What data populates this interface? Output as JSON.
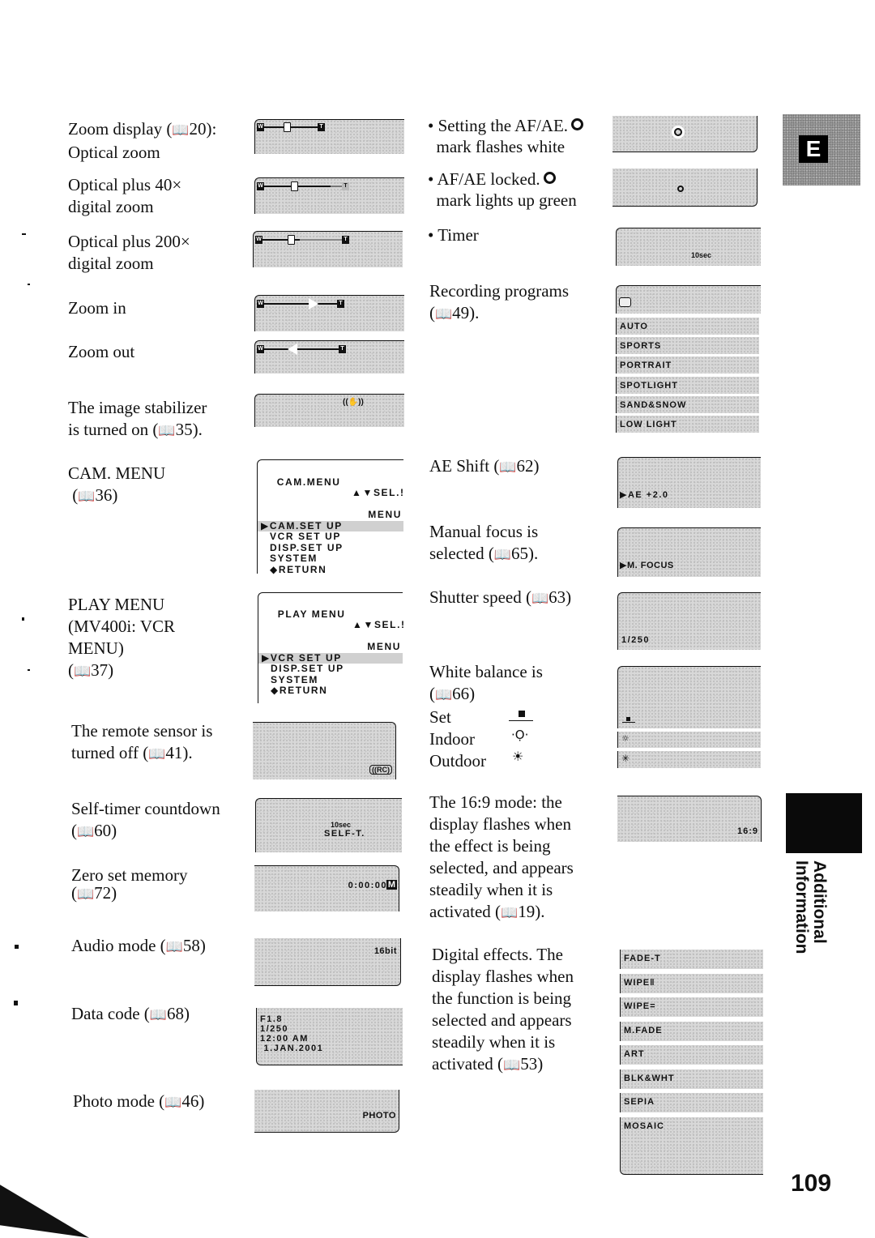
{
  "page_number": "109",
  "section_tab": "E",
  "side_tab_label": [
    "Additional",
    "Information"
  ],
  "book_icon": "book-icon",
  "left_column": [
    {
      "id": "zoom_optical",
      "lines": [
        "Zoom display (",
        "20):",
        "Optical zoom"
      ],
      "ref": "20"
    },
    {
      "id": "zoom_40x",
      "lines": [
        "Optical plus 40×",
        "digital zoom"
      ]
    },
    {
      "id": "zoom_200x",
      "lines": [
        "Optical plus 200×",
        "digital zoom"
      ]
    },
    {
      "id": "zoom_in",
      "lines": [
        "Zoom in"
      ]
    },
    {
      "id": "zoom_out",
      "lines": [
        "Zoom out"
      ]
    },
    {
      "id": "stabilizer",
      "lines": [
        "The image stabilizer",
        "is turned on (",
        "35)."
      ]
    },
    {
      "id": "cam_menu",
      "lines": [
        "CAM. MENU",
        "(",
        "36)"
      ]
    },
    {
      "id": "play_menu",
      "lines": [
        "PLAY MENU",
        "(MV400i: VCR",
        "MENU)",
        "(",
        "37)"
      ]
    },
    {
      "id": "remote",
      "lines": [
        "The remote sensor is",
        "turned off (",
        "41)."
      ]
    },
    {
      "id": "self_timer",
      "lines": [
        "Self-timer countdown",
        "(",
        "60)"
      ]
    },
    {
      "id": "zero_set",
      "lines": [
        "Zero set memory",
        "(",
        "72)"
      ]
    },
    {
      "id": "audio",
      "lines": [
        "Audio mode (",
        "58)"
      ]
    },
    {
      "id": "data_code",
      "lines": [
        "Data code (",
        "68)"
      ]
    },
    {
      "id": "photo",
      "lines": [
        "Photo mode (",
        "46)"
      ]
    }
  ],
  "zoom_bar": {
    "wide_label": "W",
    "tele_label": "T"
  },
  "cam_menu_screen": {
    "title": "CAM.MENU",
    "hint": "▲▼SEL.!",
    "hint2": "MENU",
    "items": [
      "▶CAM.SET UP",
      "VCR SET UP",
      "DISP.SET UP",
      "SYSTEM",
      "◆RETURN"
    ]
  },
  "play_menu_screen": {
    "title": "PLAY MENU",
    "hint": "▲▼SEL.!",
    "hint2": "MENU",
    "items": [
      "▶VCR SET UP",
      "DISP.SET UP",
      "SYSTEM",
      "◆RETURN"
    ]
  },
  "osd": {
    "stabilizer_icon": "((✋))",
    "remote_off": "((RC)",
    "self_timer_sec": "10sec",
    "self_timer_label": "SELF-T.",
    "zero_set": "0:00:00",
    "zero_set_badge": "M",
    "audio": "16bit",
    "data_code": [
      "F1.8",
      "1/250",
      "12:00 AM",
      " 1.JAN.2001"
    ],
    "photo": "PHOTO",
    "timer": "10sec",
    "ae_shift": "▶AE +2.0",
    "manual_focus": "▶M. FOCUS",
    "shutter": "1/250",
    "aspect": "16:9"
  },
  "right_column": {
    "af_setting": [
      "• Setting the AF/AE.",
      "mark flashes white"
    ],
    "af_locked": [
      "• AF/AE locked.",
      "mark lights up green"
    ],
    "timer": [
      "• Timer"
    ],
    "rec_programs": [
      "Recording programs",
      "(",
      "49)."
    ],
    "ae_shift": [
      "AE Shift (",
      "62)"
    ],
    "manual_focus": [
      "Manual focus is",
      "selected (",
      "65)."
    ],
    "shutter": [
      "Shutter speed (",
      "63)"
    ],
    "white_balance": {
      "lines": [
        "White balance is",
        "(",
        "66)"
      ],
      "modes": [
        {
          "label": "Set",
          "icon": "set-wb-icon"
        },
        {
          "label": "Indoor",
          "icon": "bulb-icon"
        },
        {
          "label": "Outdoor",
          "icon": "sun-icon"
        }
      ]
    },
    "aspect": [
      "The 16:9 mode: the",
      "display flashes when",
      "the effect is being",
      "selected, and appears",
      "steadily when it is",
      "activated (",
      "19)."
    ],
    "digital_effects": [
      "Digital effects. The",
      "display flashes when",
      "the function is being",
      "selected and appears",
      "steadily when it is",
      "activated (",
      "53)"
    ]
  },
  "recording_programs": [
    "AUTO",
    "SPORTS",
    "PORTRAIT",
    "SPOTLIGHT",
    "SAND&SNOW",
    "LOW LIGHT"
  ],
  "digital_effects_list": [
    "FADE-T",
    "WIPE‖",
    "WIPE=",
    "M.FADE",
    "ART",
    "BLK&WHT",
    "SEPIA",
    "MOSAIC"
  ]
}
